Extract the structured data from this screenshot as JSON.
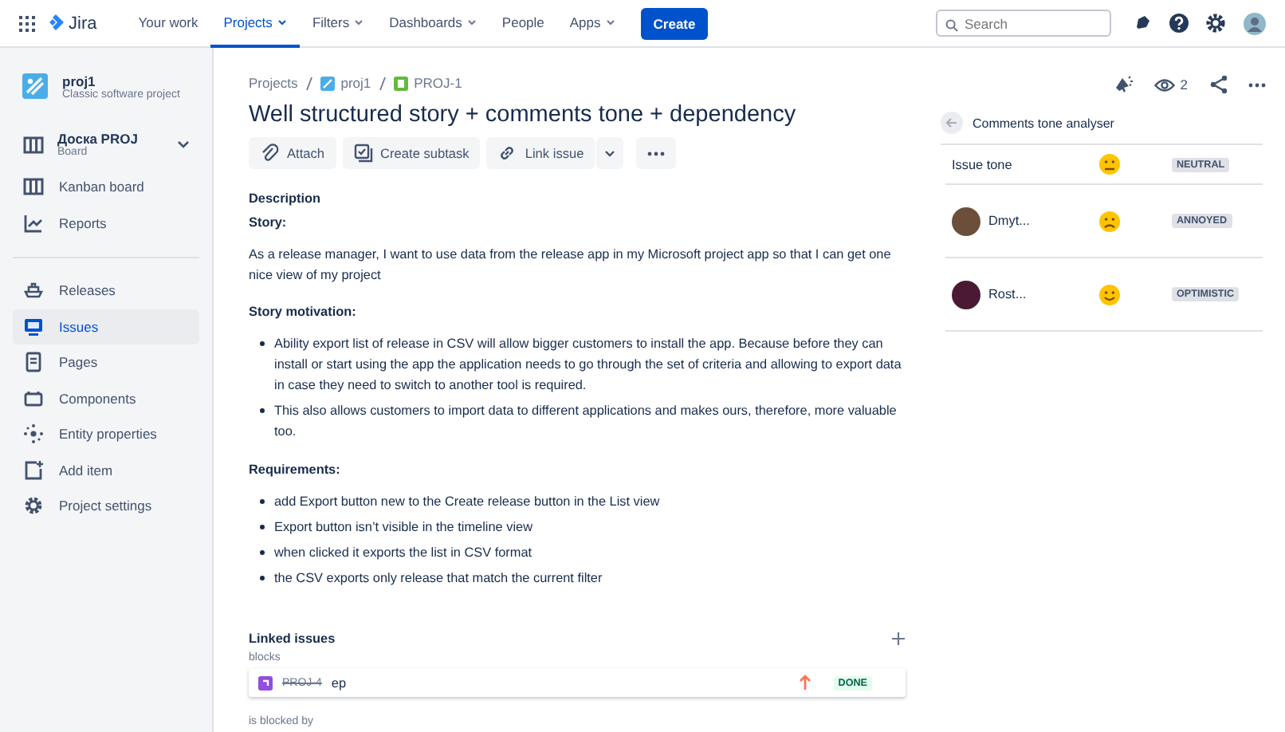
{
  "topbar": {
    "logo": "Jira",
    "nav": [
      {
        "label": "Your work",
        "selected": false,
        "dropdown": false
      },
      {
        "label": "Projects",
        "selected": true,
        "dropdown": true
      },
      {
        "label": "Filters",
        "selected": false,
        "dropdown": true
      },
      {
        "label": "Dashboards",
        "selected": false,
        "dropdown": true
      },
      {
        "label": "People",
        "selected": false,
        "dropdown": false
      },
      {
        "label": "Apps",
        "selected": false,
        "dropdown": true
      }
    ],
    "create": "Create",
    "search": {
      "placeholder": "Search"
    }
  },
  "sidebar": {
    "project": {
      "name": "proj1",
      "type": "Classic software project"
    },
    "board": {
      "name": "Доска PROJ",
      "type": "Board",
      "expanded": false
    },
    "items": [
      {
        "label": "Kanban board",
        "selected": false
      },
      {
        "label": "Reports",
        "selected": false
      },
      {
        "label": "Releases",
        "selected": false
      },
      {
        "label": "Issues",
        "selected": true
      },
      {
        "label": "Pages",
        "selected": false
      },
      {
        "label": "Components",
        "selected": false
      },
      {
        "label": "Entity properties",
        "selected": false
      },
      {
        "label": "Add item",
        "selected": false
      },
      {
        "label": "Project settings",
        "selected": false
      }
    ]
  },
  "breadcrumbs": [
    "Projects",
    "proj1",
    "PROJ-1"
  ],
  "issue": {
    "title": "Well structured story + comments tone + dependency",
    "actions": [
      "Attach",
      "Create subtask",
      "Link issue"
    ],
    "description_label": "Description",
    "blocks": [
      {
        "kind": "heading",
        "text": "Story:"
      },
      {
        "kind": "paragraph",
        "text": "As a release manager, I want to use data from the release app in my Microsoft project app so that I can get one nice view of my project"
      },
      {
        "kind": "heading",
        "text": "Story motivation:"
      },
      {
        "kind": "list",
        "items": [
          "Ability export list of release in CSV will allow bigger customers to install the app. Because before they can install or start using the app the application needs to go through the set of criteria and allowing to export data in case they need to switch to another tool is required.",
          "This also allows customers to import data to different applications and makes ours, therefore, more valuable too."
        ]
      },
      {
        "kind": "heading",
        "text": "Requirements:"
      },
      {
        "kind": "list",
        "items": [
          "add Export button new to the Create release button in the List view",
          "Export button isn’t visible in the timeline view",
          "when clicked it exports the list in CSV format",
          "the CSV exports only release that match the current filter"
        ]
      }
    ],
    "linked": {
      "title": "Linked issues",
      "groups": [
        {
          "label": "blocks",
          "items": [
            {
              "key": "PROJ-4",
              "summary": "ep",
              "resolved": true,
              "status": "DONE"
            }
          ]
        },
        {
          "label": "is blocked by"
        }
      ]
    }
  },
  "watchers": "2",
  "tone_panel": {
    "title": "Comments tone analyser",
    "rows": [
      {
        "kind": "issue",
        "name": "Issue tone",
        "tone": "NEUTRAL"
      },
      {
        "kind": "user",
        "name": "Dmyt...",
        "tone": "ANNOYED"
      },
      {
        "kind": "user",
        "name": "Rost...",
        "tone": "OPTIMISTIC"
      }
    ]
  }
}
